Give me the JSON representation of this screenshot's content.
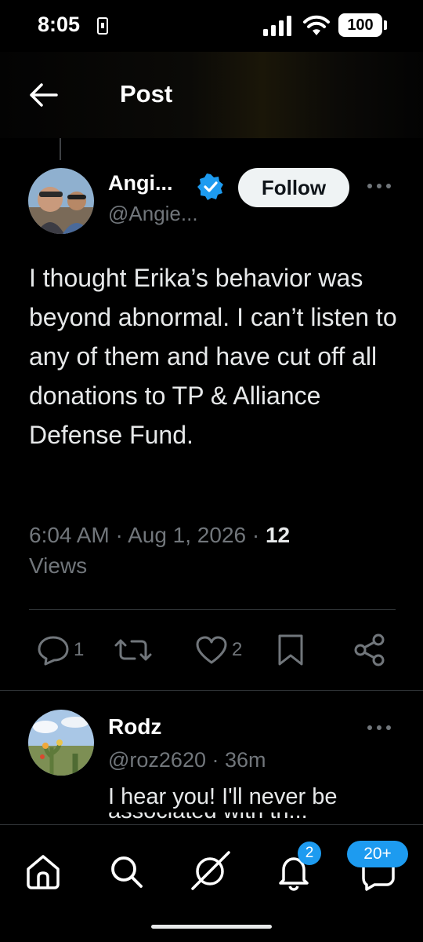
{
  "status_bar": {
    "time": "8:05",
    "battery": "100"
  },
  "header": {
    "title": "Post",
    "back_icon": "arrow-left-icon"
  },
  "post": {
    "author_name": "Angi...",
    "author_handle": "@Angie...",
    "follow_label": "Follow",
    "text": "I thought Erika’s behavior was beyond abnormal.   I can’t listen to any of them and have cut off all donations to TP & Alliance Defense Fund.",
    "timestamp": "6:04 AM · Aug 1, 2026 · ",
    "views_count": "12",
    "views_label": "Views",
    "actions": {
      "replies": "1",
      "reposts": "",
      "likes": "2"
    }
  },
  "reply": {
    "author_name": "Rodz",
    "meta": "@roz2620 · 36m",
    "text_line1": "I hear you!  I'll never be",
    "text_line2": "associated with th..."
  },
  "tab_bar": {
    "notifications_badge": "2",
    "messages_badge": "20+"
  },
  "colors": {
    "accent": "#1d9bf0",
    "muted": "#71767b",
    "text": "#e7e9ea",
    "background": "#000000"
  }
}
